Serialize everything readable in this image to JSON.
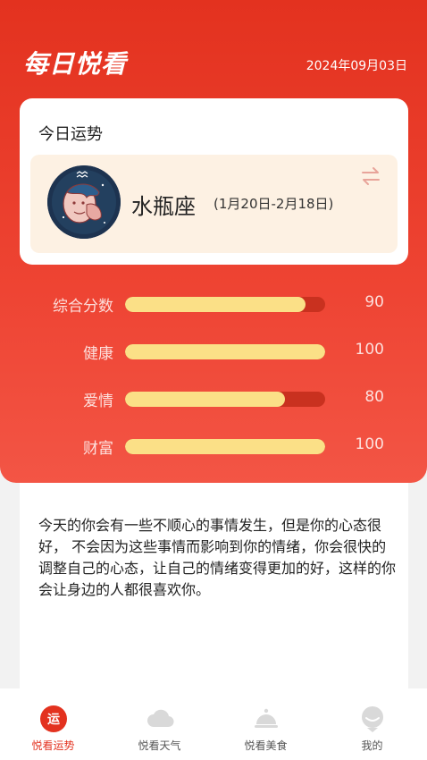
{
  "header": {
    "app_title": "每日悦看",
    "date": "2024年09月03日"
  },
  "card": {
    "title": "今日运势",
    "sign_name": "水瓶座",
    "sign_range": "(1月20日-2月18日)",
    "avatar_icon": "aquarius-avatar-icon",
    "swap_icon": "swap-arrows-icon"
  },
  "stats": [
    {
      "label": "综合分数",
      "value": "90",
      "fraction": 0.9
    },
    {
      "label": "健康",
      "value": "100",
      "fraction": 1.0
    },
    {
      "label": "爱情",
      "value": "80",
      "fraction": 0.8
    },
    {
      "label": "财富",
      "value": "100",
      "fraction": 1.0
    }
  ],
  "fortune": {
    "text": "今天的你会有一些不顺心的事情发生，但是你的心态很好， 不会因为这些事情而影响到你的情绪，你会很快的调整自己的心态，让自己的情绪变得更加的好，这样的你会让身边的人都很喜欢你。"
  },
  "tabs": [
    {
      "label": "悦看运势",
      "icon": "fortune-tab-icon",
      "active": true
    },
    {
      "label": "悦看天气",
      "icon": "cloud-icon",
      "active": false
    },
    {
      "label": "悦看美食",
      "icon": "food-cover-icon",
      "active": false
    },
    {
      "label": "我的",
      "icon": "profile-icon",
      "active": false
    }
  ],
  "colors": {
    "primary": "#e3321f",
    "bar_fill": "#fbe087",
    "bar_track": "#c9311f",
    "sign_box_bg": "#fdf1e3"
  }
}
